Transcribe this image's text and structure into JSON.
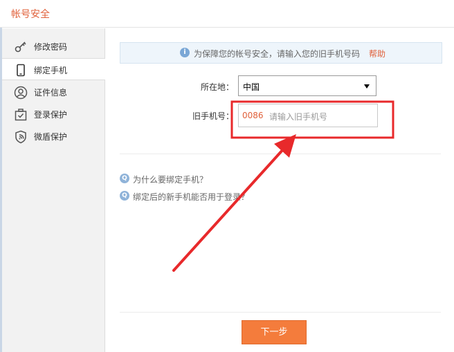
{
  "window": {
    "title": "帐号安全"
  },
  "sidebar": {
    "items": [
      {
        "label": "修改密码",
        "icon": "key-icon",
        "active": false
      },
      {
        "label": "绑定手机",
        "icon": "phone-icon",
        "active": true
      },
      {
        "label": "证件信息",
        "icon": "person-icon",
        "active": false
      },
      {
        "label": "登录保护",
        "icon": "briefcase-check-icon",
        "active": false
      },
      {
        "label": "微盾保护",
        "icon": "shield-icon",
        "active": false
      }
    ]
  },
  "notice": {
    "text": "为保障您的帐号安全，请输入您的旧手机号码",
    "help_label": "帮助",
    "icon": "info-icon"
  },
  "form": {
    "region_label": "所在地：",
    "region_value": "中国",
    "phone_label": "旧手机号：",
    "phone_prefix": "0086",
    "phone_placeholder": "请输入旧手机号"
  },
  "faq": {
    "items": [
      "为什么要绑定手机？",
      "绑定后的新手机能否用于登录？"
    ]
  },
  "actions": {
    "next_label": "下一步"
  },
  "colors": {
    "accent": "#e0603a",
    "button": "#f47c3c",
    "annotation": "#e8292b",
    "sidebar_bg": "#f2f2f2",
    "notice_bg": "#eef5fb"
  }
}
